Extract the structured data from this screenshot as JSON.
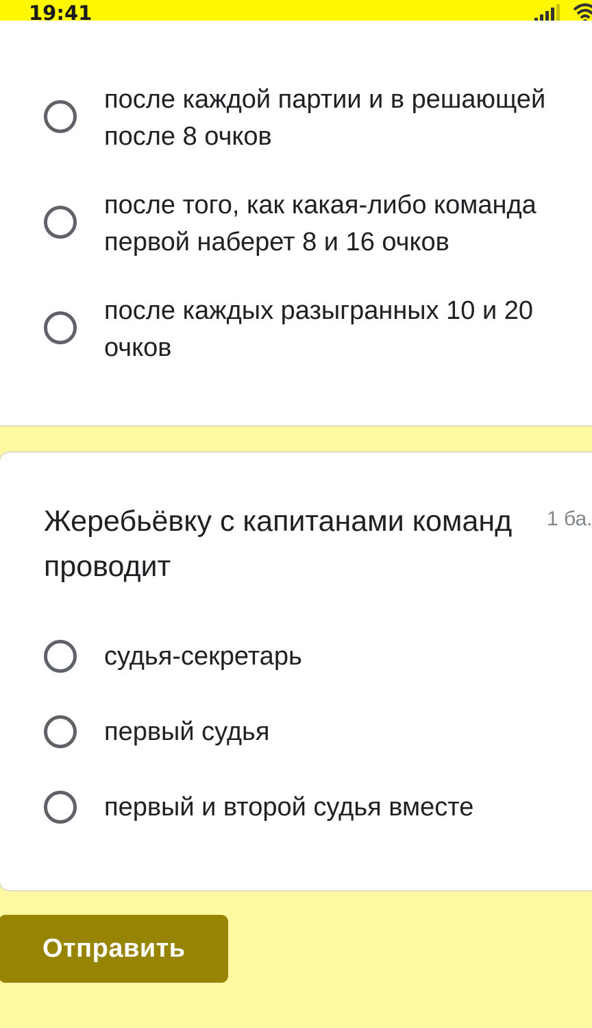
{
  "status_bar": {
    "time": "19:41"
  },
  "question_prev": {
    "options": [
      "после каждой партии и в решающей после 8 очков",
      "после того, как какая-либо команда первой наберет 8 и 16 очков",
      "после каждых разыгранных 10 и 20 очков"
    ]
  },
  "question_draw": {
    "title": "Жеребьёвку с капитанами команд проводит",
    "points": "1 ба.",
    "options": [
      "судья-секретарь",
      "первый судья",
      "первый и второй судья вместе"
    ]
  },
  "submit_label": "Отправить",
  "colors": {
    "status_bar": "#FFF703",
    "page_background": "#FEF9A0",
    "submit_button": "#978402",
    "radio_border": "#5f6368"
  }
}
